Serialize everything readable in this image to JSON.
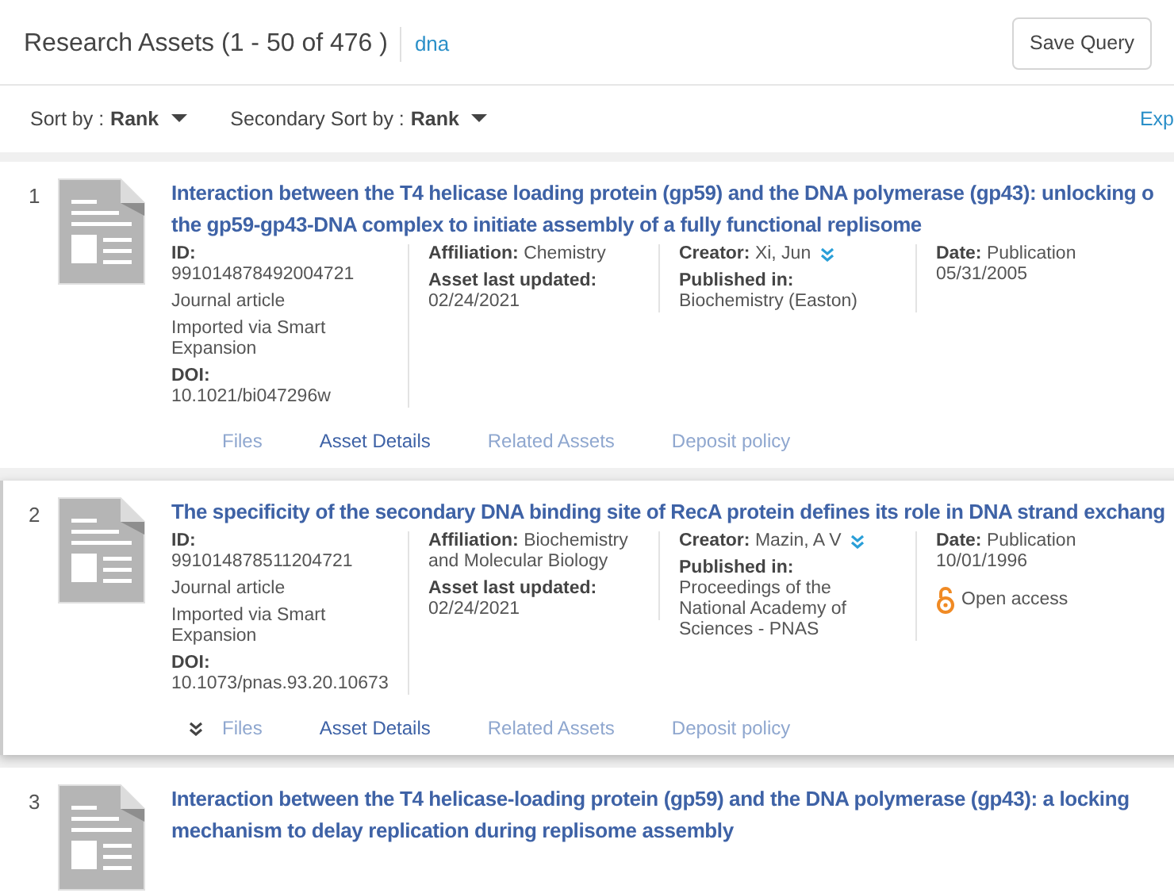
{
  "header": {
    "title": "Research Assets (1 - 50 of 476 )",
    "query": "dna",
    "save_button": "Save Query"
  },
  "sort": {
    "primary_label": "Sort by :",
    "primary_value": "Rank",
    "secondary_label": "Secondary Sort by :",
    "secondary_value": "Rank",
    "right_link": "Exp"
  },
  "assets": [
    {
      "index": "1",
      "selected": false,
      "title": "Interaction between the T4 helicase loading protein (gp59) and the DNA polymerase (gp43): unlocking o the gp59-gp43-DNA complex to initiate assembly of a fully functional replisome",
      "id_label": "ID:",
      "id": "991014878492004721",
      "type": "Journal article",
      "source": "Imported via Smart Expansion",
      "doi_label": "DOI:",
      "doi": "10.1021/bi047296w",
      "affiliation_label": "Affiliation:",
      "affiliation": "Chemistry",
      "updated_label": "Asset last updated:",
      "updated": "02/24/2021",
      "creator_label": "Creator:",
      "creator": "Xi, Jun",
      "published_label": "Published in:",
      "published": "Biochemistry (Easton)",
      "date_label": "Date:",
      "date_kind": "Publication",
      "date": "05/31/2005",
      "open_access": false,
      "actions": [
        {
          "label": "Files",
          "disabled": true
        },
        {
          "label": "Asset Details",
          "disabled": false
        },
        {
          "label": "Related Assets",
          "disabled": true
        },
        {
          "label": "Deposit policy",
          "disabled": true
        }
      ]
    },
    {
      "index": "2",
      "selected": true,
      "title": "The specificity of the secondary DNA binding site of RecA protein defines its role in DNA strand exchang",
      "id_label": "ID:",
      "id": "991014878511204721",
      "type": "Journal article",
      "source": "Imported via Smart Expansion",
      "doi_label": "DOI:",
      "doi": "10.1073/pnas.93.20.10673",
      "affiliation_label": "Affiliation:",
      "affiliation": "Biochemistry and Molecular Biology",
      "updated_label": "Asset last updated:",
      "updated": "02/24/2021",
      "creator_label": "Creator:",
      "creator": "Mazin, A V",
      "published_label": "Published in:",
      "published": "Proceedings of the National Academy of Sciences - PNAS",
      "date_label": "Date:",
      "date_kind": "Publication",
      "date": "10/01/1996",
      "open_access": true,
      "open_access_label": "Open access",
      "actions": [
        {
          "label": "Files",
          "disabled": true
        },
        {
          "label": "Asset Details",
          "disabled": false
        },
        {
          "label": "Related Assets",
          "disabled": true
        },
        {
          "label": "Deposit policy",
          "disabled": true
        }
      ]
    },
    {
      "index": "3",
      "selected": false,
      "title": "Interaction between the T4 helicase-loading protein (gp59) and the DNA polymerase (gp43): a locking mechanism to delay replication during replisome assembly"
    }
  ]
}
